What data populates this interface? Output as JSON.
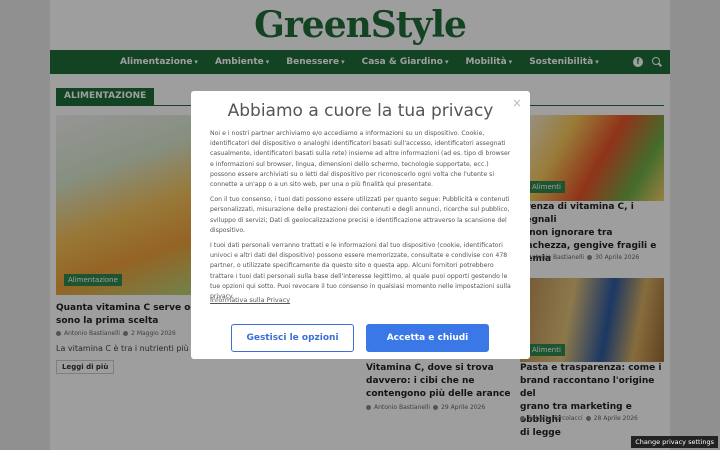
{
  "site": {
    "logo": "GreenStyle"
  },
  "nav": {
    "items": [
      {
        "label": "Alimentazione"
      },
      {
        "label": "Ambiente"
      },
      {
        "label": "Benessere"
      },
      {
        "label": "Casa & Giardino"
      },
      {
        "label": "Mobilità"
      },
      {
        "label": "Sostenibilità"
      }
    ],
    "facebook_icon": "facebook-icon",
    "search_icon": "search-icon"
  },
  "section": {
    "title": "ALIMENTAZIONE"
  },
  "articles": [
    {
      "category": "Alimentazione",
      "title": "Quanta vitamina C serve ogni giorno? Ecco quali sono la prima scelta",
      "title_visible": "Quanta vitamina C serve ogni",
      "title_line2": "sono la prima scelta",
      "author": "Antonio Bastianelli",
      "date": "2 Maggio 2026",
      "excerpt": "La vitamina C è tra i nutrienti più",
      "readmore": "Leggi di più"
    },
    {
      "category": "Alimenti",
      "title_line1": "arenza di vitamina C, i segnali",
      "title_line2": "a non ignorare tra",
      "title_line3": "anchezza, gengive fragili e",
      "title_line4": "nemia",
      "author": "Antonio Bastianelli",
      "date": "30 Aprile 2026"
    },
    {
      "title_line1": "Vitamina C, dove si trova",
      "title_line2": "davvero: i cibi che ne",
      "title_line3": "contengono più delle arance",
      "author": "Antonio Bastianelli",
      "date": "29 Aprile 2026"
    },
    {
      "category": "Alimenti",
      "title_line1": "Pasta e trasparenza: come i",
      "title_line2": "brand raccontano l'origine del",
      "title_line3": "grano tra marketing e obblighi",
      "title_line4": "di legge",
      "author": "Roberto Torcolacci",
      "date": "28 Aprile 2026"
    }
  ],
  "consent": {
    "title": "Abbiamo a cuore la tua privacy",
    "close": "×",
    "paragraph1": "Noi e i nostri partner archiviamo e/o accediamo a informazioni su un dispositivo. Cookie, identificatori del dispositivo o analoghi identificatori basati sull'accesso, identificatori assegnati casualmente, identificatori basati sulla rete) insieme ad altre informazioni (ad es. tipo di browser e informazioni sul browser, lingua, dimensioni dello schermo, tecnologie supportate, ecc.) possono essere archiviati su o letti dal dispositivo per riconoscerlo ogni volta che l'utente si connette a un'app o a un sito web, per una o più finalità qui presentate.",
    "paragraph2": "Con il tuo consenso, i tuoi dati possono essere utilizzati per quanto segue: Pubblicità e contenuti personalizzati, misurazione delle prestazioni dei contenuti e degli annunci, ricerche sul pubblico, sviluppo di servizi; Dati di geolocalizzazione precisi e identificazione attraverso la scansione del dispositivo.",
    "paragraph3": "I tuoi dati personali verranno trattati e le informazioni dal tuo dispositivo (cookie, identificatori univoci e altri dati del dispositivo) possono essere memorizzate, consultate e condivise con 478 partner, o utilizzate specificamente da questo sito o questa app. Alcuni fornitori potrebbero trattare i tuoi dati personali sulla base dell'interesse legittimo, al quale puoi opporti gestendo le tue opzioni qui sotto. Puoi revocare il tuo consenso in qualsiasi momento nelle impostazioni sulla privacy.",
    "policy_link": "Informativa sulla Privacy",
    "manage_button": "Gestisci le opzioni",
    "accept_button": "Accetta e chiudi"
  },
  "footer": {
    "change_privacy": "Change privacy settings"
  }
}
